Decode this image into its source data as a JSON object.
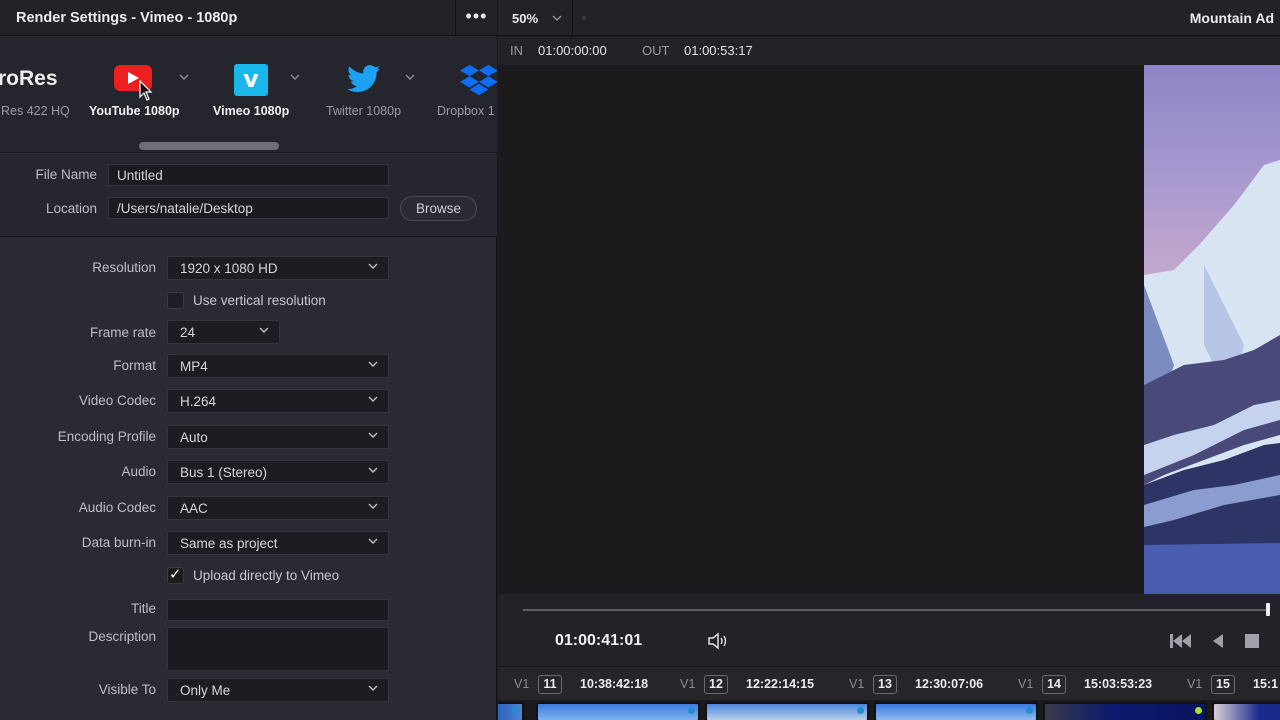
{
  "render_panel": {
    "title": "Render Settings - Vimeo - 1080p",
    "more_icon": "ellipsis-icon",
    "presets": [
      {
        "name": "ProRes",
        "icon_text": "roRes",
        "label": "Res 422 HQ",
        "active": false
      },
      {
        "name": "YouTube",
        "icon": "youtube-icon",
        "label": "YouTube 1080p",
        "active": true
      },
      {
        "name": "Vimeo",
        "icon": "vimeo-icon",
        "icon_text": "v",
        "label": "Vimeo 1080p",
        "active": true
      },
      {
        "name": "Twitter",
        "icon": "twitter-icon",
        "label": "Twitter 1080p",
        "active": false
      },
      {
        "name": "Dropbox",
        "icon": "dropbox-icon",
        "label": "Dropbox 1",
        "active": false
      }
    ],
    "file_name": {
      "label": "File Name",
      "value": "Untitled"
    },
    "location": {
      "label": "Location",
      "value": "/Users/natalie/Desktop",
      "browse_label": "Browse"
    },
    "resolution": {
      "label": "Resolution",
      "value": "1920 x 1080 HD"
    },
    "vertical_resolution": {
      "label": "Use vertical resolution",
      "checked": false
    },
    "frame_rate": {
      "label": "Frame rate",
      "value": "24"
    },
    "format": {
      "label": "Format",
      "value": "MP4"
    },
    "video_codec": {
      "label": "Video Codec",
      "value": "H.264"
    },
    "encoding_profile": {
      "label": "Encoding Profile",
      "value": "Auto"
    },
    "audio": {
      "label": "Audio",
      "value": "Bus 1 (Stereo)"
    },
    "audio_codec": {
      "label": "Audio Codec",
      "value": "AAC"
    },
    "data_burn_in": {
      "label": "Data burn-in",
      "value": "Same as project"
    },
    "upload_vimeo": {
      "label": "Upload directly to Vimeo",
      "checked": true,
      "tick": "✓"
    },
    "title_field": {
      "label": "Title",
      "value": ""
    },
    "description_field": {
      "label": "Description",
      "value": ""
    },
    "visible_to": {
      "label": "Visible To",
      "value": "Only Me"
    }
  },
  "viewer": {
    "zoom": "50%",
    "title": "Mountain Ad",
    "in_label": "IN",
    "in_value": "01:00:00:00",
    "out_label": "OUT",
    "out_value": "01:00:53:17",
    "timecode": "01:00:41:01",
    "playhead_fraction": 0.998
  },
  "clips": [
    {
      "track": "V1",
      "number": "11",
      "timecode": "10:38:42:18",
      "flag_color": "#1f8fd0"
    },
    {
      "track": "V1",
      "number": "12",
      "timecode": "12:22:14:15",
      "flag_color": "#1f8fd0"
    },
    {
      "track": "V1",
      "number": "13",
      "timecode": "12:30:07:06",
      "flag_color": "#1f8fd0"
    },
    {
      "track": "V1",
      "number": "14",
      "timecode": "15:03:53:23",
      "flag_color": "#a6e22e"
    },
    {
      "track": "V1",
      "number": "15",
      "timecode": "15:1",
      "flag_color": ""
    }
  ],
  "colors": {
    "youtube": "#ee1f1f",
    "vimeo": "#1ab7ea",
    "twitter": "#1da1f2",
    "dropbox": "#0d6ef5"
  }
}
